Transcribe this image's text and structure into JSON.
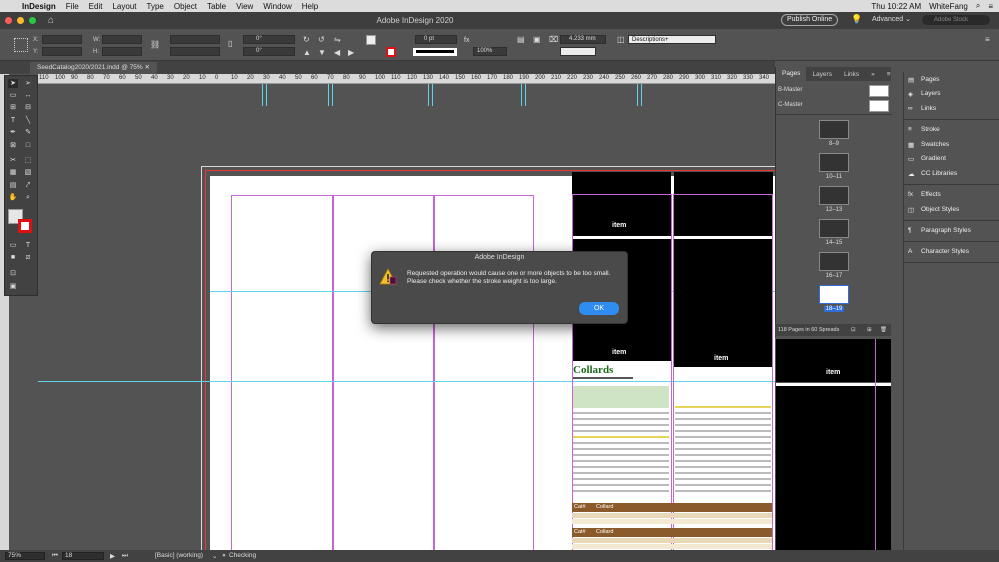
{
  "menubar": {
    "app_name": "InDesign",
    "items": [
      "File",
      "Edit",
      "Layout",
      "Type",
      "Object",
      "Table",
      "View",
      "Window",
      "Help"
    ],
    "clock": "Thu 10:22 AM",
    "user": "WhiteFang"
  },
  "appbar": {
    "title": "Adobe InDesign 2020",
    "publish_label": "Publish Online",
    "workspace": "Advanced",
    "search_placeholder": "Adobe Stock"
  },
  "controlbar": {
    "x_label": "X:",
    "y_label": "Y:",
    "w_label": "W:",
    "h_label": "H:",
    "rotate_value": "0°",
    "shear_value": "0°",
    "stroke_weight": "0 pt",
    "opacity": "100%",
    "fitting_value": "4.233 mm",
    "object_style": "Descriptions+"
  },
  "document": {
    "tab_label": "SeedCatalog2020/2021.indd @ 75%"
  },
  "ruler": {
    "ticks": [
      "110",
      "100",
      "90",
      "80",
      "70",
      "60",
      "50",
      "40",
      "30",
      "20",
      "10",
      "0",
      "10",
      "20",
      "30",
      "40",
      "50",
      "60",
      "70",
      "80",
      "90",
      "100",
      "110",
      "120",
      "130",
      "140",
      "150",
      "160",
      "170",
      "180",
      "190",
      "200",
      "210",
      "220",
      "230",
      "240",
      "250",
      "260",
      "270",
      "280",
      "290",
      "300",
      "310",
      "320",
      "330",
      "340"
    ]
  },
  "canvas": {
    "item_label": "item",
    "collards_title": "Collards",
    "table_header_cat": "Cat#",
    "table_header_name": "Collard"
  },
  "dialog": {
    "title": "Adobe InDesign",
    "message_line1": "Requested operation would cause one or more objects to be too small.",
    "message_line2": "Please check whether the stroke weight is too large.",
    "ok_label": "OK"
  },
  "pages_panel": {
    "tabs": [
      "Pages",
      "Layers",
      "Links"
    ],
    "masters": [
      "B-Master",
      "C-Master"
    ],
    "spreads": [
      "8–9",
      "10–11",
      "12–13",
      "14–15",
      "16–17",
      "18–19"
    ],
    "selected_spread": "18–19",
    "footer": "118 Pages in 60 Spreads"
  },
  "right_panels": {
    "group1": [
      "Pages",
      "Layers",
      "Links"
    ],
    "group2": [
      "Stroke",
      "Swatches",
      "Gradient",
      "CC Libraries"
    ],
    "group3": [
      "Effects",
      "Object Styles"
    ],
    "group4": [
      "Paragraph Styles"
    ],
    "group5": [
      "Character Styles"
    ]
  },
  "statusbar": {
    "zoom": "75%",
    "page": "18",
    "master": "[Basic] (working)",
    "preflight": "Checking"
  }
}
